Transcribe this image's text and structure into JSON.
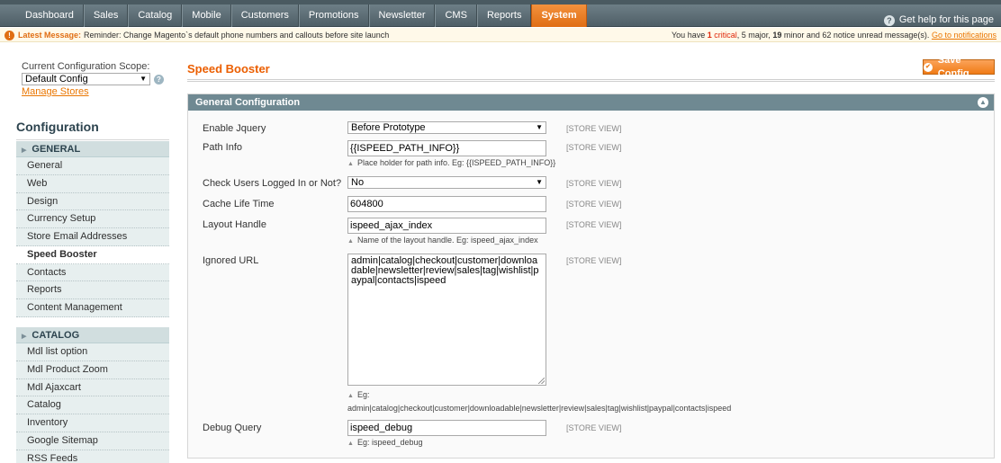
{
  "nav": {
    "items": [
      "Dashboard",
      "Sales",
      "Catalog",
      "Mobile",
      "Customers",
      "Promotions",
      "Newsletter",
      "CMS",
      "Reports",
      "System"
    ],
    "active_index": 9,
    "help": "Get help for this page"
  },
  "message": {
    "label": "Latest Message:",
    "text": "Reminder: Change Magento`s default phone numbers and callouts before site launch",
    "summary_prefix": "You have",
    "critical_count": "1",
    "critical_label": "critical",
    "major": ", 5 major,",
    "minor_count": "19",
    "rest": "minor and 62 notice unread message(s).",
    "link": "Go to notifications"
  },
  "sidebar": {
    "scope_label": "Current Configuration Scope:",
    "scope_value": "Default Config",
    "manage_stores": "Manage Stores",
    "config_title": "Configuration",
    "general_head": "GENERAL",
    "general_items": [
      "General",
      "Web",
      "Design",
      "Currency Setup",
      "Store Email Addresses",
      "Speed Booster",
      "Contacts",
      "Reports",
      "Content Management"
    ],
    "active_item": "Speed Booster",
    "catalog_head": "CATALOG",
    "catalog_items": [
      "Mdl list option",
      "Mdl Product Zoom",
      "Mdl Ajaxcart",
      "Catalog",
      "Inventory",
      "Google Sitemap",
      "RSS Feeds"
    ]
  },
  "main": {
    "title": "Speed Booster",
    "save_label": "Save Config",
    "section_title": "General Configuration",
    "scope_tag": "[STORE VIEW]",
    "fields": {
      "jquery_label": "Enable Jquery",
      "jquery_value": "Before Prototype",
      "path_label": "Path Info",
      "path_value": "{{ISPEED_PATH_INFO}}",
      "path_note": "Place holder for path info. Eg: {{ISPEED_PATH_INFO}}",
      "users_label": "Check Users Logged In or Not?",
      "users_value": "No",
      "cache_label": "Cache Life Time",
      "cache_value": "604800",
      "layout_label": "Layout Handle",
      "layout_value": "ispeed_ajax_index",
      "layout_note": "Name of the layout handle. Eg: ispeed_ajax_index",
      "ignored_label": "Ignored URL",
      "ignored_value": "admin|catalog|checkout|customer|downloadable|newsletter|review|sales|tag|wishlist|paypal|contacts|ispeed",
      "ignored_note_eg": "Eg:",
      "ignored_note": "admin|catalog|checkout|customer|downloadable|newsletter|review|sales|tag|wishlist|paypal|contacts|ispeed",
      "debug_label": "Debug Query",
      "debug_value": "ispeed_debug",
      "debug_note": "Eg: ispeed_debug"
    }
  },
  "colors": {
    "accent": "#eb5e00",
    "nav_active": "#f07b16",
    "section_head": "#6f8992",
    "critical": "#df280a"
  }
}
